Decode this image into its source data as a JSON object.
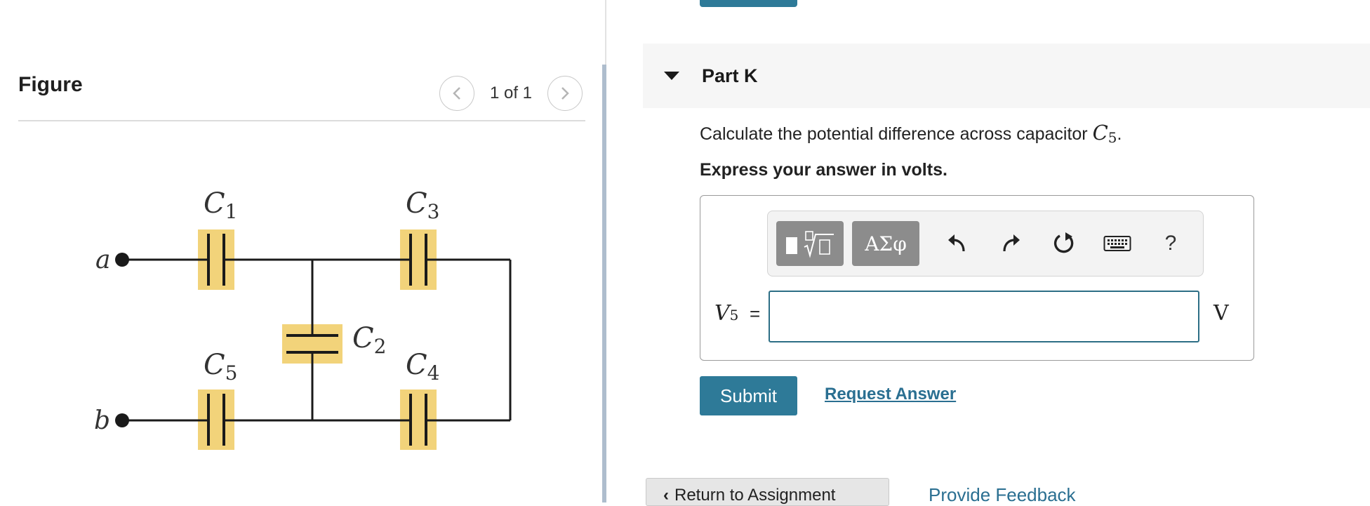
{
  "figure": {
    "title": "Figure",
    "pager_text": "1 of 1",
    "circuit": {
      "node_a": "a",
      "node_b": "b",
      "capacitors": [
        {
          "letter": "C",
          "sub": "1"
        },
        {
          "letter": "C",
          "sub": "2"
        },
        {
          "letter": "C",
          "sub": "3"
        },
        {
          "letter": "C",
          "sub": "4"
        },
        {
          "letter": "C",
          "sub": "5"
        }
      ]
    }
  },
  "part": {
    "title": "Part K",
    "question_text": "Calculate the potential difference across capacitor",
    "question_var": "C",
    "question_sub": "5",
    "question_end": ".",
    "instruction": "Express your answer in volts."
  },
  "answer": {
    "var_letter": "V",
    "var_sub": "5",
    "equals": "=",
    "value": "",
    "placeholder": "",
    "unit": "V"
  },
  "toolbar": {
    "greek_label": "ΑΣφ",
    "help_label": "?",
    "icons": [
      "templates-icon",
      "undo-icon",
      "redo-icon",
      "reset-icon",
      "keyboard-icon"
    ]
  },
  "actions": {
    "submit_label": "Submit",
    "request_answer_label": "Request Answer",
    "return_label": "Return to Assignment",
    "feedback_label": "Provide Feedback"
  },
  "colors": {
    "primary": "#2e7a98",
    "link": "#2a6f91",
    "capacitor_highlight": "#f2d37a",
    "wire": "#1a1a1a"
  }
}
